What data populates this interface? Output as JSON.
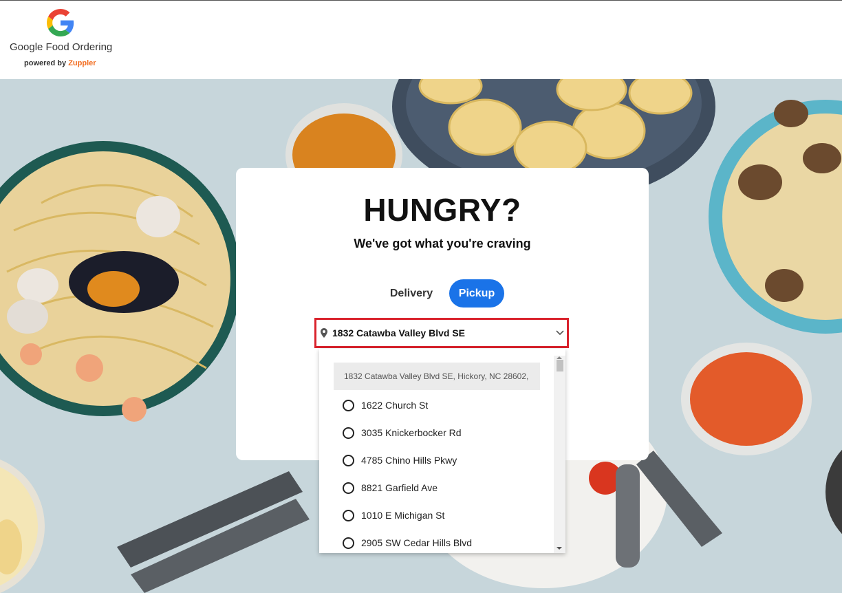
{
  "header": {
    "brand_name": "Google Food Ordering",
    "powered_prefix": "powered by ",
    "powered_brand": "Zuppler",
    "logo_icon": "google-g-logo"
  },
  "card": {
    "title": "HUNGRY?",
    "subtitle": "We've got what you're craving",
    "modes": [
      {
        "label": "Delivery",
        "selected": false
      },
      {
        "label": "Pickup",
        "selected": true
      }
    ]
  },
  "address_select": {
    "value": "1832 Catawba Valley Blvd SE",
    "icon": "map-pin-icon",
    "chevron": "chevron-down-icon"
  },
  "dropdown": {
    "search_value": "1832 Catawba Valley Blvd SE, Hickory, NC 28602,",
    "options": [
      "1622 Church St",
      "3035 Knickerbocker Rd",
      "4785 Chino Hills Pkwy",
      "8821 Garfield Ave",
      "1010 E Michigan St",
      "2905 SW Cedar Hills Blvd"
    ]
  },
  "colors": {
    "accent": "#1a73e8",
    "highlight_border": "#d9232d",
    "zuppler": "#f26b1d"
  }
}
